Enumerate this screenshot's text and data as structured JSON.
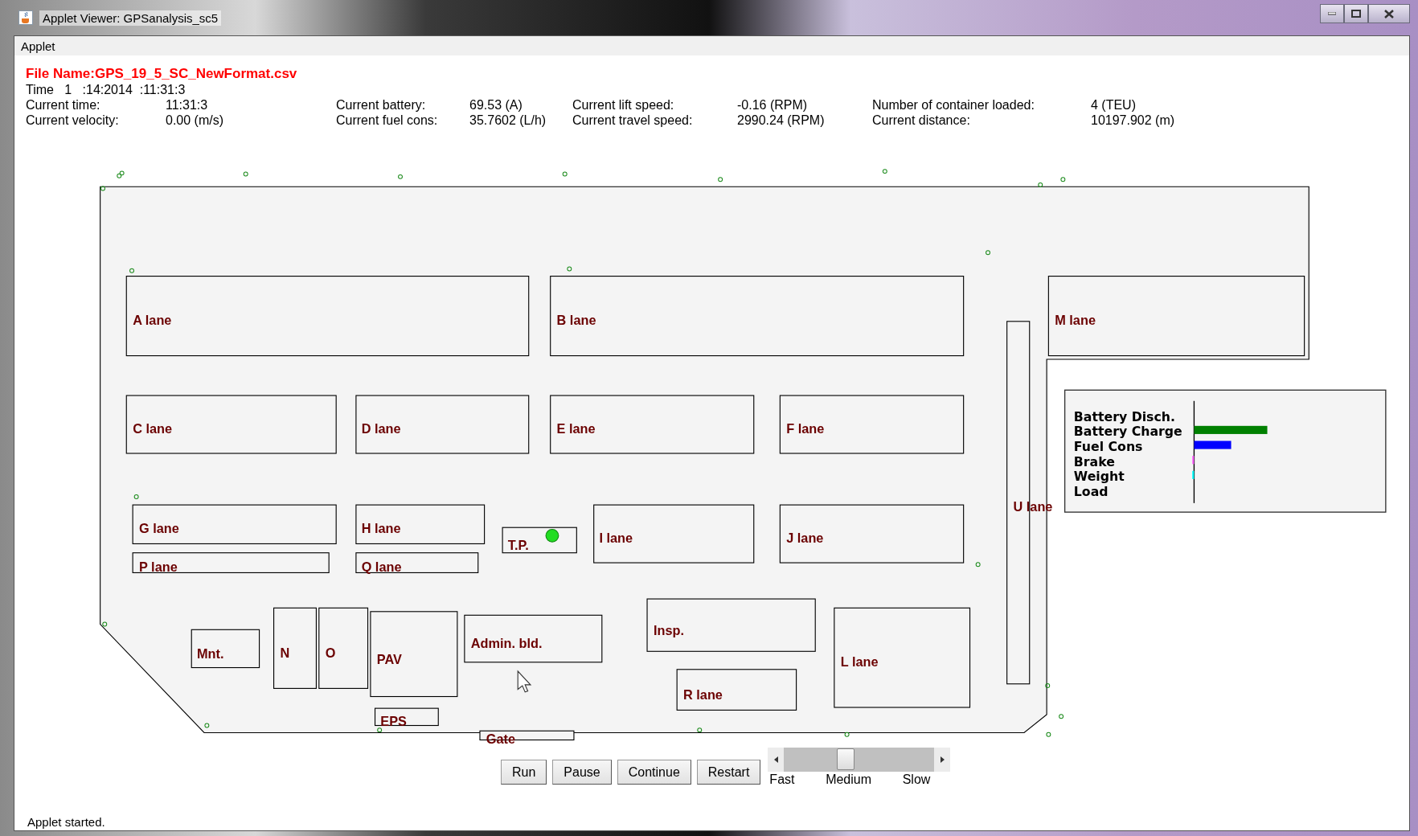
{
  "window": {
    "title": "Applet Viewer: GPSanalysis_sc5"
  },
  "menu": [
    "Applet"
  ],
  "file_name": "File Name:GPS_19_5_SC_NewFormat.csv",
  "time_line": "Time   1   :14:2014  :11:31:3",
  "readings": [
    {
      "label": "Current time:",
      "value": "11:31:3"
    },
    {
      "label": "Current battery:",
      "value": "69.53 (A)"
    },
    {
      "label": "Current lift speed:",
      "value": "-0.16 (RPM)"
    },
    {
      "label": "Number of container loaded:",
      "value": "4 (TEU)"
    },
    {
      "label": "Current velocity:",
      "value": "0.00 (m/s)"
    },
    {
      "label": "Current fuel cons:",
      "value": "35.7602 (L/h)"
    },
    {
      "label": "Current travel speed:",
      "value": "2990.24 (RPM)"
    },
    {
      "label": "Current distance:",
      "value": "10197.902 (m)"
    }
  ],
  "map": {
    "areas": [
      {
        "label": "A lane"
      },
      {
        "label": "B lane"
      },
      {
        "label": "M lane"
      },
      {
        "label": "U lane"
      },
      {
        "label": "C lane"
      },
      {
        "label": "D lane"
      },
      {
        "label": "E lane"
      },
      {
        "label": "F lane"
      },
      {
        "label": "G lane"
      },
      {
        "label": "H lane"
      },
      {
        "label": "P lane"
      },
      {
        "label": "Q lane"
      },
      {
        "label": "T.P."
      },
      {
        "label": "I lane"
      },
      {
        "label": "J lane"
      },
      {
        "label": "Mnt."
      },
      {
        "label": "N"
      },
      {
        "label": "O"
      },
      {
        "label": "PAV"
      },
      {
        "label": "Admin. bld."
      },
      {
        "label": "Insp."
      },
      {
        "label": "R lane"
      },
      {
        "label": "L lane"
      },
      {
        "label": "EPS"
      },
      {
        "label": "Gate"
      }
    ],
    "legend": [
      {
        "label": "Battery Disch."
      },
      {
        "label": "Battery Charge",
        "color": "#008000"
      },
      {
        "label": "Fuel Cons",
        "color": "#0000ff"
      },
      {
        "label": "Brake",
        "color": "#ff66ff"
      },
      {
        "label": "Weight",
        "color": "#00ffff"
      },
      {
        "label": "Load"
      }
    ]
  },
  "buttons": [
    "Run",
    "Pause",
    "Continue",
    "Restart"
  ],
  "speed": {
    "level": 0.4,
    "labels": [
      "Fast",
      "Medium",
      "Slow"
    ]
  },
  "status": "Applet started."
}
